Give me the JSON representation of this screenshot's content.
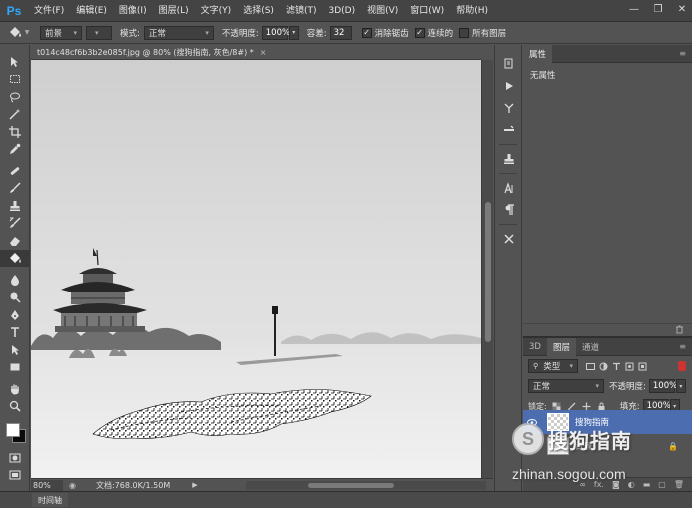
{
  "app": {
    "logo": "Ps"
  },
  "menu": [
    "文件(F)",
    "编辑(E)",
    "图像(I)",
    "图层(L)",
    "文字(Y)",
    "选择(S)",
    "滤镜(T)",
    "3D(D)",
    "视图(V)",
    "窗口(W)",
    "帮助(H)"
  ],
  "window_controls": {
    "minimize": "—",
    "restore": "❐",
    "close": "✕"
  },
  "options": {
    "fill_source": "前景",
    "mode_label": "模式:",
    "mode_value": "正常",
    "opacity_label": "不透明度:",
    "opacity_value": "100%",
    "tolerance_label": "容差:",
    "tolerance_value": "32",
    "antialias_label": "消除锯齿",
    "contiguous_label": "连续的",
    "all_layers_label": "所有图层"
  },
  "document": {
    "tab_title": "t014c48cf6b3b2e085f.jpg @ 80% (搜狗指南, 灰色/8#) *",
    "tab_close": "×"
  },
  "status": {
    "zoom": "80%",
    "doc_info": "文档:768.0K/1.50M"
  },
  "timeline_tab": "时间轴",
  "properties_panel": {
    "tab": "属性",
    "empty_text": "无属性"
  },
  "layers_panel": {
    "tabs": [
      "3D",
      "图层",
      "通道"
    ],
    "filter_type": "类型",
    "blend_mode": "正常",
    "opacity_label": "不透明度:",
    "opacity_value": "100%",
    "lock_label": "锁定:",
    "fill_label": "填充:",
    "fill_value": "100%",
    "layers": [
      {
        "name": "搜狗指南",
        "selected": true
      },
      {
        "name": "背景",
        "selected": false
      }
    ],
    "footer_icons": [
      "link-icon",
      "fx-icon",
      "mask-icon",
      "adjustment-icon",
      "folder-icon",
      "new-layer-icon",
      "trash-icon"
    ],
    "footer_fx": "fx."
  },
  "watermark": {
    "logo_letter": "S",
    "text": "搜狗指南",
    "url": "zhinan.sogou.com"
  },
  "colors": {
    "accent": "#31a8ff",
    "selected_layer": "#4c6eb1",
    "foreground": "#ffffff",
    "background": "#0b0b0b"
  }
}
